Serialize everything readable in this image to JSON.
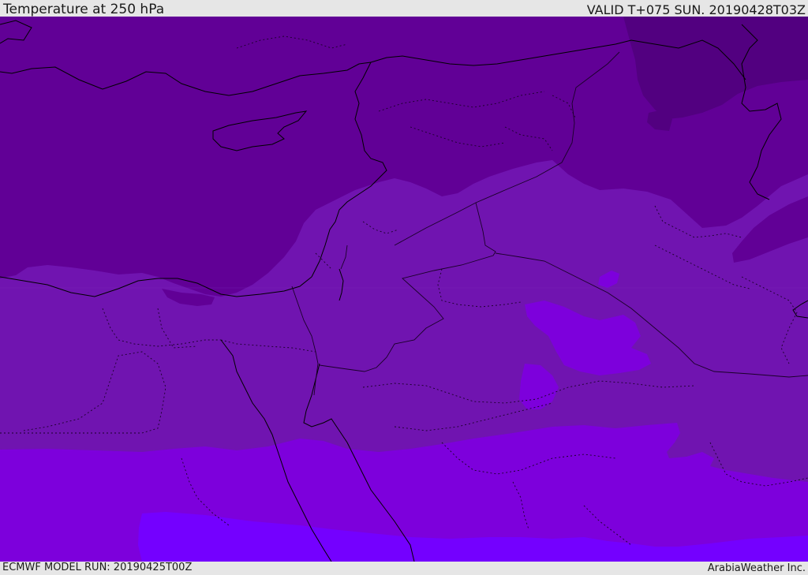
{
  "header": {
    "title": "Temperature at 250 hPa",
    "valid": "VALID T+075 SUN. 20190428T03Z"
  },
  "footer": {
    "model_run": "ECMWF MODEL RUN: 20190425T00Z",
    "credit": "ArabiaWeather Inc."
  },
  "map": {
    "type": "filled-contour-temperature-map",
    "region": "Eastern Mediterranean / Middle East",
    "field": "temperature",
    "level": "250 hPa",
    "colors": {
      "band_coldest": "#520080",
      "band_cold": "#610096",
      "band_mid": "#7014b0",
      "band_warm": "#7d00dc",
      "band_warmest": "#7400ff",
      "coastline": "#000000",
      "border": "#1a0028"
    }
  }
}
